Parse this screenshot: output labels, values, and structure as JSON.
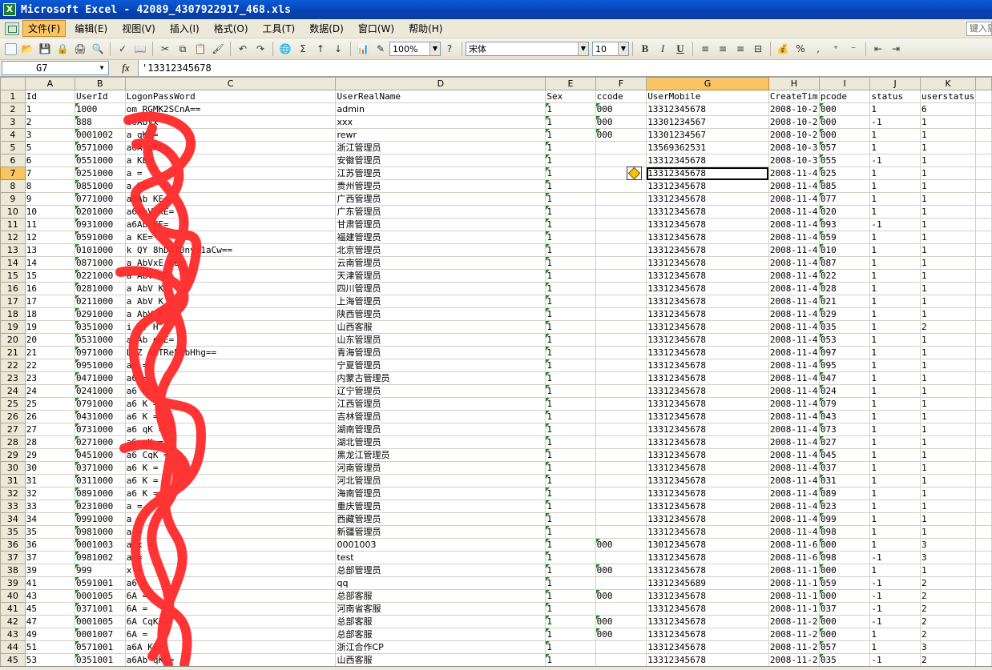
{
  "window": {
    "title": "Microsoft Excel - 42089_4307922917_468.xls",
    "app_icon": "excel-icon"
  },
  "menu": {
    "items": [
      "文件(F)",
      "编辑(E)",
      "视图(V)",
      "插入(I)",
      "格式(O)",
      "工具(T)",
      "数据(D)",
      "窗口(W)",
      "帮助(H)"
    ],
    "help_box": "键入需"
  },
  "toolbar": {
    "zoom": "100%",
    "font": "宋体",
    "font_size": "10",
    "bold": "B",
    "italic": "I",
    "underline": "U",
    "sum": "Σ",
    "percent": "%",
    "comma": ","
  },
  "formula_bar": {
    "cell_ref": "G7",
    "fx": "fx",
    "value": "'13312345678"
  },
  "columns": [
    "A",
    "B",
    "C",
    "D",
    "E",
    "F",
    "G",
    "H",
    "I",
    "J",
    "K"
  ],
  "headers": [
    "Id",
    "UserId",
    "LogonPassWord",
    "UserRealName",
    "Sex",
    "ccode",
    "UserMobile",
    "CreateTim",
    "pcode",
    "status",
    "userstatus"
  ],
  "rows": [
    {
      "row": "2",
      "cells": [
        "1",
        "1000",
        "om    RGMK2SCnA==",
        "admin",
        "1",
        "000",
        "13312345678",
        "2008-10-2",
        "000",
        "1",
        "6"
      ]
    },
    {
      "row": "3",
      "cells": [
        "2",
        "888",
        "a6AbVx",
        "xxx",
        "1",
        "000",
        "13301234567",
        "2008-10-2",
        "000",
        "-1",
        "1"
      ]
    },
    {
      "row": "4",
      "cells": [
        "3",
        "0001002",
        "a    qKE=",
        "rewr",
        "1",
        "000",
        "13301234567",
        "2008-10-2",
        "000",
        "1",
        "1"
      ]
    },
    {
      "row": "5",
      "cells": [
        "5",
        "0571000",
        "a6A  qKE=",
        "浙江管理员",
        "1",
        "",
        "13569362531",
        "2008-10-3",
        "057",
        "1",
        "1"
      ]
    },
    {
      "row": "6",
      "cells": [
        "6",
        "0551000",
        "a  KE=",
        "安徽管理员",
        "1",
        "",
        "13312345678",
        "2008-10-3",
        "055",
        "-1",
        "1"
      ]
    },
    {
      "row": "7",
      "cells": [
        "7",
        "0251000",
        "a   =",
        "江苏管理员",
        "1",
        "",
        "13312345678",
        "2008-11-4",
        "025",
        "1",
        "1"
      ]
    },
    {
      "row": "8",
      "cells": [
        "8",
        "0851000",
        "a  KE=",
        "贵州管理员",
        "1",
        "",
        "13312345678",
        "2008-11-4",
        "085",
        "1",
        "1"
      ]
    },
    {
      "row": "9",
      "cells": [
        "9",
        "0771000",
        "a6Ab  KE=",
        "广西管理员",
        "1",
        "",
        "13312345678",
        "2008-11-4",
        "077",
        "1",
        "1"
      ]
    },
    {
      "row": "10",
      "cells": [
        "10",
        "0201000",
        "a6AbV  KE=",
        "广东管理员",
        "1",
        "",
        "13312345678",
        "2008-11-4",
        "020",
        "1",
        "1"
      ]
    },
    {
      "row": "11",
      "cells": [
        "11",
        "0931000",
        "a6Ab  KE=",
        "甘肃管理员",
        "1",
        "",
        "13312345678",
        "2008-11-4",
        "093",
        "-1",
        "1"
      ]
    },
    {
      "row": "12",
      "cells": [
        "12",
        "0591000",
        "a  KE=",
        "福建管理员",
        "1",
        "",
        "13312345678",
        "2008-11-4",
        "059",
        "1",
        "1"
      ]
    },
    {
      "row": "13",
      "cells": [
        "13",
        "0101000",
        "k  QY  8hD4T0nyi1aCw==",
        "北京管理员",
        "1",
        "",
        "13312345678",
        "2008-11-4",
        "010",
        "1",
        "1"
      ]
    },
    {
      "row": "14",
      "cells": [
        "14",
        "0871000",
        "a   AbVxE  KE=",
        "云南管理员",
        "1",
        "",
        "13312345678",
        "2008-11-4",
        "087",
        "1",
        "1"
      ]
    },
    {
      "row": "15",
      "cells": [
        "15",
        "0221000",
        "a  AbV  KE=",
        "天津管理员",
        "1",
        "",
        "13312345678",
        "2008-11-4",
        "022",
        "1",
        "1"
      ]
    },
    {
      "row": "16",
      "cells": [
        "16",
        "0281000",
        "a  AbV  K",
        "四川管理员",
        "1",
        "",
        "13312345678",
        "2008-11-4",
        "028",
        "1",
        "1"
      ]
    },
    {
      "row": "17",
      "cells": [
        "17",
        "0211000",
        "a  AbV  K",
        "上海管理员",
        "1",
        "",
        "13312345678",
        "2008-11-4",
        "021",
        "1",
        "1"
      ]
    },
    {
      "row": "18",
      "cells": [
        "18",
        "0291000",
        "a  AbV  K",
        "陕西管理员",
        "1",
        "",
        "13312345678",
        "2008-11-4",
        "029",
        "1",
        "1"
      ]
    },
    {
      "row": "19",
      "cells": [
        "19",
        "0351000",
        "i  cT  H",
        "山西客服",
        "1",
        "",
        "13312345678",
        "2008-11-4",
        "035",
        "1",
        "2"
      ]
    },
    {
      "row": "20",
      "cells": [
        "20",
        "0531000",
        "a  Ab  qKE=",
        "山东管理员",
        "1",
        "",
        "13312345678",
        "2008-11-4",
        "053",
        "1",
        "1"
      ]
    },
    {
      "row": "21",
      "cells": [
        "21",
        "0971000",
        "L  Z  AkTReEgbHhg==",
        "青海管理员",
        "1",
        "",
        "13312345678",
        "2008-11-4",
        "097",
        "1",
        "1"
      ]
    },
    {
      "row": "22",
      "cells": [
        "22",
        "0951000",
        "a6  =",
        "宁夏管理员",
        "1",
        "",
        "13312345678",
        "2008-11-4",
        "095",
        "1",
        "1"
      ]
    },
    {
      "row": "23",
      "cells": [
        "23",
        "0471000",
        "a6  =",
        "内蒙古管理员",
        "1",
        "",
        "13312345678",
        "2008-11-4",
        "047",
        "1",
        "1"
      ]
    },
    {
      "row": "24",
      "cells": [
        "24",
        "0241000",
        "a6  K  =",
        "辽宁管理员",
        "1",
        "",
        "13312345678",
        "2008-11-4",
        "024",
        "1",
        "1"
      ]
    },
    {
      "row": "25",
      "cells": [
        "25",
        "0791000",
        "a6  K  =",
        "江西管理员",
        "1",
        "",
        "13312345678",
        "2008-11-4",
        "079",
        "1",
        "1"
      ]
    },
    {
      "row": "26",
      "cells": [
        "26",
        "0431000",
        "a6  K  =",
        "吉林管理员",
        "1",
        "",
        "13312345678",
        "2008-11-4",
        "043",
        "1",
        "1"
      ]
    },
    {
      "row": "27",
      "cells": [
        "27",
        "0731000",
        "a6  qK  =",
        "湖南管理员",
        "1",
        "",
        "13312345678",
        "2008-11-4",
        "073",
        "1",
        "1"
      ]
    },
    {
      "row": "28",
      "cells": [
        "28",
        "0271000",
        "a6  qK  =",
        "湖北管理员",
        "1",
        "",
        "13312345678",
        "2008-11-4",
        "027",
        "1",
        "1"
      ]
    },
    {
      "row": "29",
      "cells": [
        "29",
        "0451000",
        "a6  CqK  =",
        "黑龙江管理员",
        "1",
        "",
        "13312345678",
        "2008-11-4",
        "045",
        "1",
        "1"
      ]
    },
    {
      "row": "30",
      "cells": [
        "30",
        "0371000",
        "a6  K  =",
        "河南管理员",
        "1",
        "",
        "13312345678",
        "2008-11-4",
        "037",
        "1",
        "1"
      ]
    },
    {
      "row": "31",
      "cells": [
        "31",
        "0311000",
        "a6  K  =",
        "河北管理员",
        "1",
        "",
        "13312345678",
        "2008-11-4",
        "031",
        "1",
        "1"
      ]
    },
    {
      "row": "32",
      "cells": [
        "32",
        "0891000",
        "a6  K  =",
        "海南管理员",
        "1",
        "",
        "13312345678",
        "2008-11-4",
        "089",
        "1",
        "1"
      ]
    },
    {
      "row": "33",
      "cells": [
        "33",
        "0231000",
        "a  =",
        "重庆管理员",
        "1",
        "",
        "13312345678",
        "2008-11-4",
        "023",
        "1",
        "1"
      ]
    },
    {
      "row": "34",
      "cells": [
        "34",
        "0991000",
        "a  =",
        "西藏管理员",
        "1",
        "",
        "13312345678",
        "2008-11-4",
        "099",
        "1",
        "1"
      ]
    },
    {
      "row": "35",
      "cells": [
        "35",
        "0981000",
        "a  =",
        "新疆管理员",
        "1",
        "",
        "13312345678",
        "2008-11-4",
        "098",
        "1",
        "1"
      ]
    },
    {
      "row": "36",
      "cells": [
        "36",
        "0001003",
        "a  x  =",
        "0001003",
        "1",
        "000",
        "13012345678",
        "2008-11-6",
        "000",
        "1",
        "3"
      ]
    },
    {
      "row": "37",
      "cells": [
        "37",
        "0981002",
        "a  =",
        "test",
        "1",
        "",
        "13312345678",
        "2008-11-6",
        "098",
        "-1",
        "3"
      ]
    },
    {
      "row": "38",
      "cells": [
        "39",
        "999",
        "  x  =",
        "总部管理员",
        "1",
        "000",
        "13312345678",
        "2008-11-1",
        "000",
        "1",
        "1"
      ]
    },
    {
      "row": "39",
      "cells": [
        "41",
        "0591001",
        "a6  =",
        "qq",
        "1",
        "",
        "13312345689",
        "2008-11-1",
        "059",
        "-1",
        "2"
      ]
    },
    {
      "row": "40",
      "cells": [
        "43",
        "0001005",
        "6A  =",
        "总部客服",
        "1",
        "000",
        "13312345678",
        "2008-11-1",
        "000",
        "-1",
        "2"
      ]
    },
    {
      "row": "41",
      "cells": [
        "45",
        "0371001",
        "6A  =",
        "河南省客服",
        "1",
        "",
        "13312345678",
        "2008-11-1",
        "037",
        "-1",
        "2"
      ]
    },
    {
      "row": "42",
      "cells": [
        "47",
        "0001005",
        "6A  CqKE=",
        "总部客服",
        "1",
        "000",
        "13312345678",
        "2008-11-2",
        "000",
        "-1",
        "2"
      ]
    },
    {
      "row": "43",
      "cells": [
        "49",
        "0001007",
        "6A  =",
        "总部客服",
        "1",
        "000",
        "13312345678",
        "2008-11-2",
        "000",
        "1",
        "2"
      ]
    },
    {
      "row": "44",
      "cells": [
        "51",
        "0571001",
        "a6A  KE=",
        "浙江合作CP",
        "1",
        "",
        "13312345678",
        "2008-11-2",
        "057",
        "1",
        "3"
      ]
    },
    {
      "row": "45",
      "cells": [
        "53",
        "0351001",
        "a6Ab  qKE=",
        "山西客服",
        "1",
        "",
        "13312345678",
        "2008-11-2",
        "035",
        "-1",
        "2"
      ]
    }
  ],
  "selection": {
    "row": "7",
    "column": "G"
  },
  "colors": {
    "titlebar": "#0a5bd8",
    "active_header": "#f9c463",
    "scribble": "#ff2a2a",
    "text_marker": "#1a8a1a"
  }
}
